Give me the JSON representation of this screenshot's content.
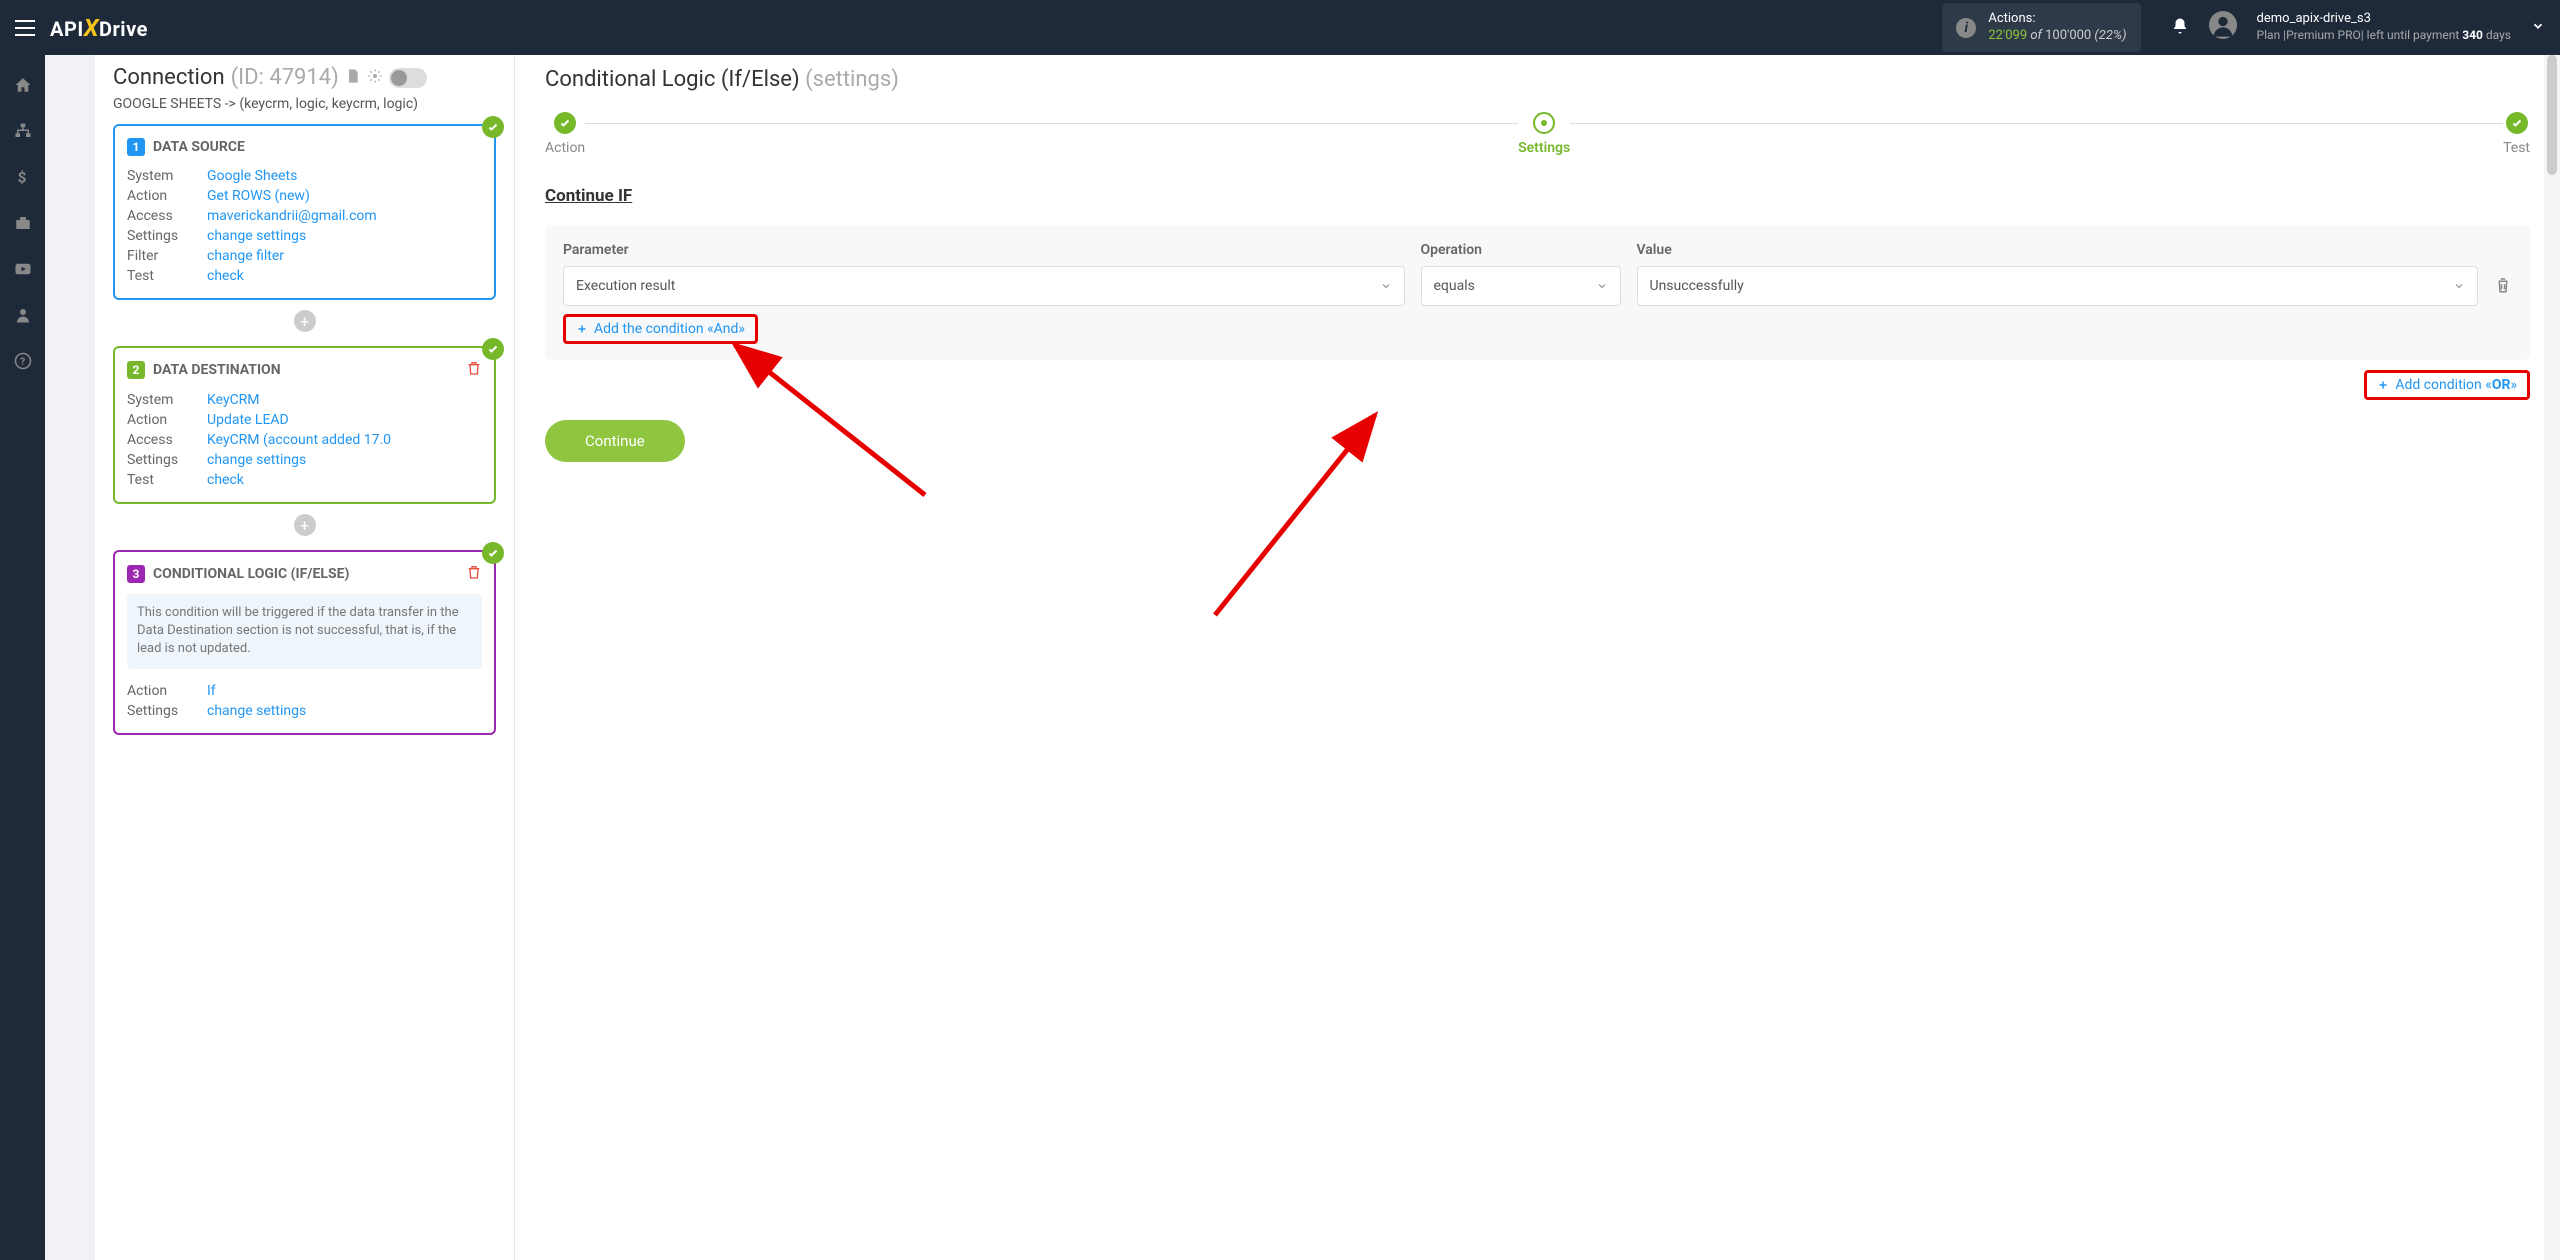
{
  "topbar": {
    "logo_prefix": "API",
    "logo_suffix": "Drive",
    "actions_label": "Actions:",
    "actions_count": "22'099",
    "actions_of": " of ",
    "actions_total": "100'000",
    "actions_pct": " (22%)",
    "username": "demo_apix-drive_s3",
    "plan_prefix": "Plan |Premium PRO| left until payment ",
    "plan_days": "340",
    "plan_suffix": " days"
  },
  "left": {
    "title": "Connection",
    "title_id": " (ID: 47914)",
    "subtitle": "GOOGLE SHEETS -> (keycrm, logic, keycrm, logic)",
    "card1": {
      "title": "DATA SOURCE",
      "rows": {
        "system_l": "System",
        "system_v": "Google Sheets",
        "action_l": "Action",
        "action_v": "Get ROWS (new)",
        "access_l": "Access",
        "access_v": "maverickandrii@gmail.com",
        "settings_l": "Settings",
        "settings_v": "change settings",
        "filter_l": "Filter",
        "filter_v": "change filter",
        "test_l": "Test",
        "test_v": "check"
      }
    },
    "card2": {
      "title": "DATA DESTINATION",
      "rows": {
        "system_l": "System",
        "system_v": "KeyCRM",
        "action_l": "Action",
        "action_v": "Update LEAD",
        "access_l": "Access",
        "access_v": "KeyCRM (account added 17.0",
        "settings_l": "Settings",
        "settings_v": "change settings",
        "test_l": "Test",
        "test_v": "check"
      }
    },
    "card3": {
      "title": "CONDITIONAL LOGIC (IF/ELSE)",
      "note": "This condition will be triggered if the data transfer in the Data Destination section is not successful, that is, if the lead is not updated.",
      "rows": {
        "action_l": "Action",
        "action_v": "If",
        "settings_l": "Settings",
        "settings_v": "change settings"
      }
    }
  },
  "main": {
    "title": "Conditional Logic (If/Else) ",
    "title_sub": "(settings)",
    "steps": {
      "s1": "Action",
      "s2": "Settings",
      "s3": "Test"
    },
    "section": "Continue IF",
    "labels": {
      "param": "Parameter",
      "op": "Operation",
      "val": "Value"
    },
    "values": {
      "param": "Execution result",
      "op": "equals",
      "val": "Unsuccessfully"
    },
    "add_and": "Add the condition «And»",
    "add_or_prefix": "Add condition «",
    "add_or_bold": "OR",
    "add_or_suffix": "»",
    "continue": "Continue"
  }
}
